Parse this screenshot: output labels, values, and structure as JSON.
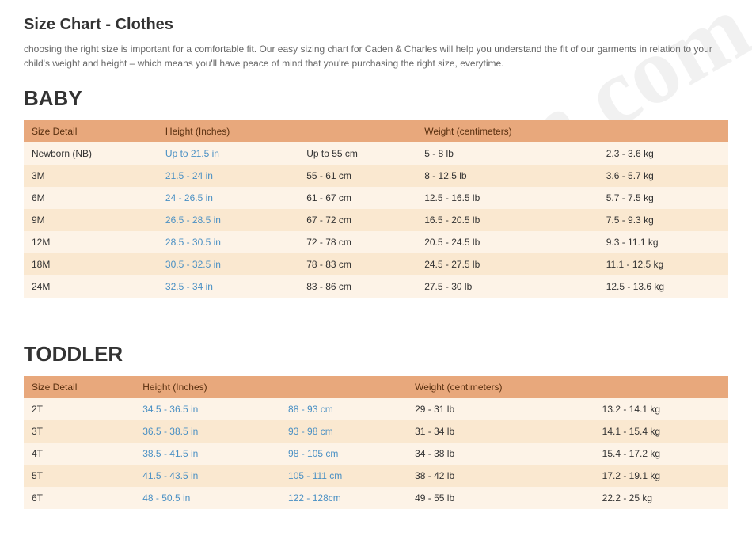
{
  "page": {
    "title": "Size Chart - Clothes",
    "intro": "choosing the right size is important for a comfortable fit. Our easy sizing chart for Caden & Charles will help you understand the fit of our garments in relation to your child's weight and height – which means you'll have peace of mind that you're purchasing the right size, everytime.",
    "watermark": "Crisban.com"
  },
  "baby": {
    "section_title": "BABY",
    "headers": [
      "Size Detail",
      "Height (Inches)",
      "",
      "Weight (centimeters)",
      ""
    ],
    "rows": [
      [
        "Newborn (NB)",
        "Up to 21.5 in",
        "Up to 55 cm",
        "5 - 8 lb",
        "2.3 - 3.6 kg"
      ],
      [
        "3M",
        "21.5 - 24 in",
        "55 - 61 cm",
        "8 - 12.5 lb",
        "3.6 - 5.7 kg"
      ],
      [
        "6M",
        "24 - 26.5 in",
        "61 - 67 cm",
        "12.5 - 16.5 lb",
        "5.7 - 7.5 kg"
      ],
      [
        "9M",
        "26.5 - 28.5 in",
        "67 - 72 cm",
        "16.5 - 20.5 lb",
        "7.5 - 9.3 kg"
      ],
      [
        "12M",
        "28.5 - 30.5 in",
        "72 - 78 cm",
        "20.5 - 24.5 lb",
        "9.3 - 11.1 kg"
      ],
      [
        "18M",
        "30.5 - 32.5 in",
        "78 - 83 cm",
        "24.5 - 27.5 lb",
        "11.1 - 12.5 kg"
      ],
      [
        "24M",
        "32.5 - 34 in",
        "83 - 86 cm",
        "27.5 - 30 lb",
        "12.5 - 13.6 kg"
      ]
    ]
  },
  "toddler": {
    "section_title": "TODDLER",
    "headers": [
      "Size Detail",
      "Height (Inches)",
      "",
      "Weight (centimeters)",
      ""
    ],
    "rows": [
      [
        "2T",
        "34.5 - 36.5 in",
        "88 - 93 cm",
        "29 - 31 lb",
        "13.2 - 14.1 kg"
      ],
      [
        "3T",
        "36.5 - 38.5 in",
        "93 - 98 cm",
        "31 - 34 lb",
        "14.1 - 15.4 kg"
      ],
      [
        "4T",
        "38.5 - 41.5 in",
        "98 - 105 cm",
        "34 - 38 lb",
        "15.4 - 17.2 kg"
      ],
      [
        "5T",
        "41.5 - 43.5 in",
        "105 - 111 cm",
        "38 - 42 lb",
        "17.2 - 19.1 kg"
      ],
      [
        "6T",
        "48 - 50.5 in",
        "122 - 128cm",
        "49 - 55 lb",
        "22.2 - 25 kg"
      ]
    ],
    "link_cols": [
      1,
      2
    ]
  }
}
